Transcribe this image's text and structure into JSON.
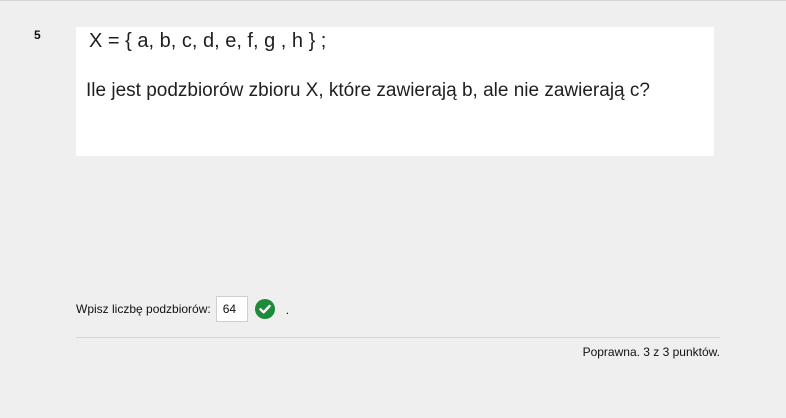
{
  "question": {
    "number": "5",
    "set_definition": "X =  { a, b, c, d, e, f, g , h } ;",
    "prompt": "Ile jest podzbiorów zbioru  X,  które zawierają  b,   ale nie zawierają  c?"
  },
  "answer": {
    "label": "Wpisz liczbę podzbiorów:",
    "value": "64",
    "status_icon": "check-circle-icon",
    "status_color": "#1e8a3c",
    "trailing_text": "."
  },
  "feedback": {
    "score_text": "Poprawna. 3 z 3 punktów."
  }
}
